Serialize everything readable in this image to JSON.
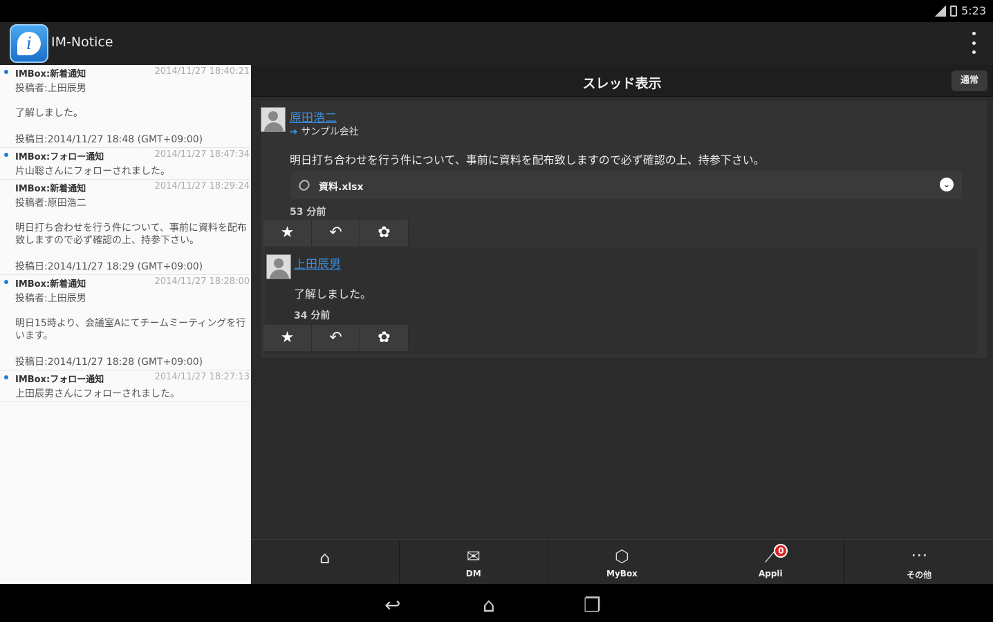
{
  "status": {
    "time": "5:23"
  },
  "app": {
    "title": "IM-Notice"
  },
  "notifications": [
    {
      "title": "IMBox:新着通知",
      "date": "2014/11/27 18:40:21",
      "line": "投稿者:上田辰男",
      "body": "了解しました。",
      "posted": "投稿日:2014/11/27 18:48 (GMT+09:00)"
    },
    {
      "title": "IMBox:フォロー通知",
      "date": "2014/11/27 18:47:34",
      "line": "片山聡さんにフォローされました。"
    },
    {
      "title": "IMBox:新着通知",
      "date": "2014/11/27 18:29:24",
      "line": "投稿者:原田浩二",
      "body": "明日打ち合わせを行う件について、事前に資料を配布致しますので必ず確認の上、持参下さい。",
      "posted": "投稿日:2014/11/27 18:29 (GMT+09:00)"
    },
    {
      "title": "IMBox:新着通知",
      "date": "2014/11/27 18:28:00",
      "line": "投稿者:上田辰男",
      "body": "明日15時より、会議室Aにてチームミーティングを行います。",
      "posted": "投稿日:2014/11/27 18:28 (GMT+09:00)"
    },
    {
      "title": "IMBox:フォロー通知",
      "date": "2014/11/27 18:27:13",
      "line": "上田辰男さんにフォローされました。"
    }
  ],
  "thread": {
    "header": "スレッド表示",
    "back_label": "通常",
    "post": {
      "user": "原田浩二",
      "destination": "サンプル会社",
      "message": "明日打ち合わせを行う件について、事前に資料を配布致しますので必ず確認の上、持参下さい。",
      "attachment": "資料.xlsx",
      "ago": "53 分前"
    },
    "reply": {
      "user": "上田辰男",
      "message": "了解しました。",
      "ago": "34 分前"
    }
  },
  "bottom_nav": {
    "dm": "DM",
    "mybox": "MyBox",
    "appli": "Appli",
    "appli_badge": "0",
    "more": "その他"
  }
}
